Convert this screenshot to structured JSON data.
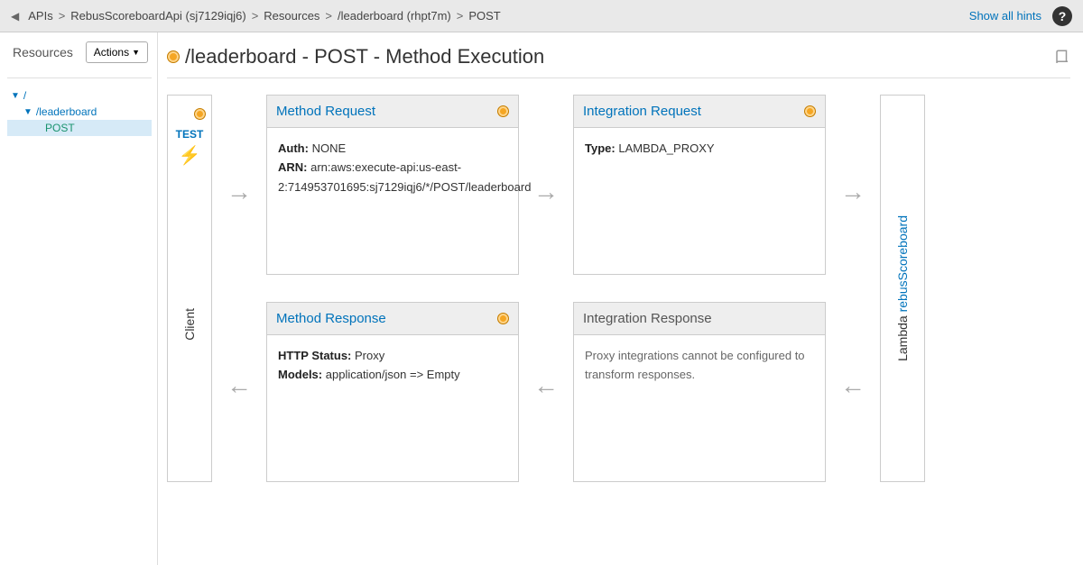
{
  "breadcrumb": {
    "items": [
      "APIs",
      "RebusScoreboardApi (sj7129iqj6)",
      "Resources",
      "/leaderboard (rhpt7m)",
      "POST"
    ]
  },
  "topRight": {
    "showHints": "Show all hints"
  },
  "sidebar": {
    "title": "Resources",
    "actions": "Actions",
    "tree": {
      "root": "/",
      "resource": "/leaderboard",
      "method": "POST"
    }
  },
  "header": {
    "title": "/leaderboard - POST - Method Execution"
  },
  "client": {
    "label": "Client",
    "test": "TEST"
  },
  "lambda": {
    "prefix": "Lambda ",
    "name": "rebusScoreboard"
  },
  "cards": {
    "methodRequest": {
      "title": "Method Request",
      "authLabel": "Auth:",
      "auth": "NONE",
      "arnLabel": "ARN:",
      "arn": "arn:aws:execute-api:us-east-2:714953701695:sj7129iqj6/*/POST/leaderboard"
    },
    "integrationRequest": {
      "title": "Integration Request",
      "typeLabel": "Type:",
      "type": "LAMBDA_PROXY"
    },
    "methodResponse": {
      "title": "Method Response",
      "statusLabel": "HTTP Status:",
      "status": "Proxy",
      "modelsLabel": "Models:",
      "models": "application/json => Empty"
    },
    "integrationResponse": {
      "title": "Integration Response",
      "body": "Proxy integrations cannot be configured to transform responses."
    }
  }
}
